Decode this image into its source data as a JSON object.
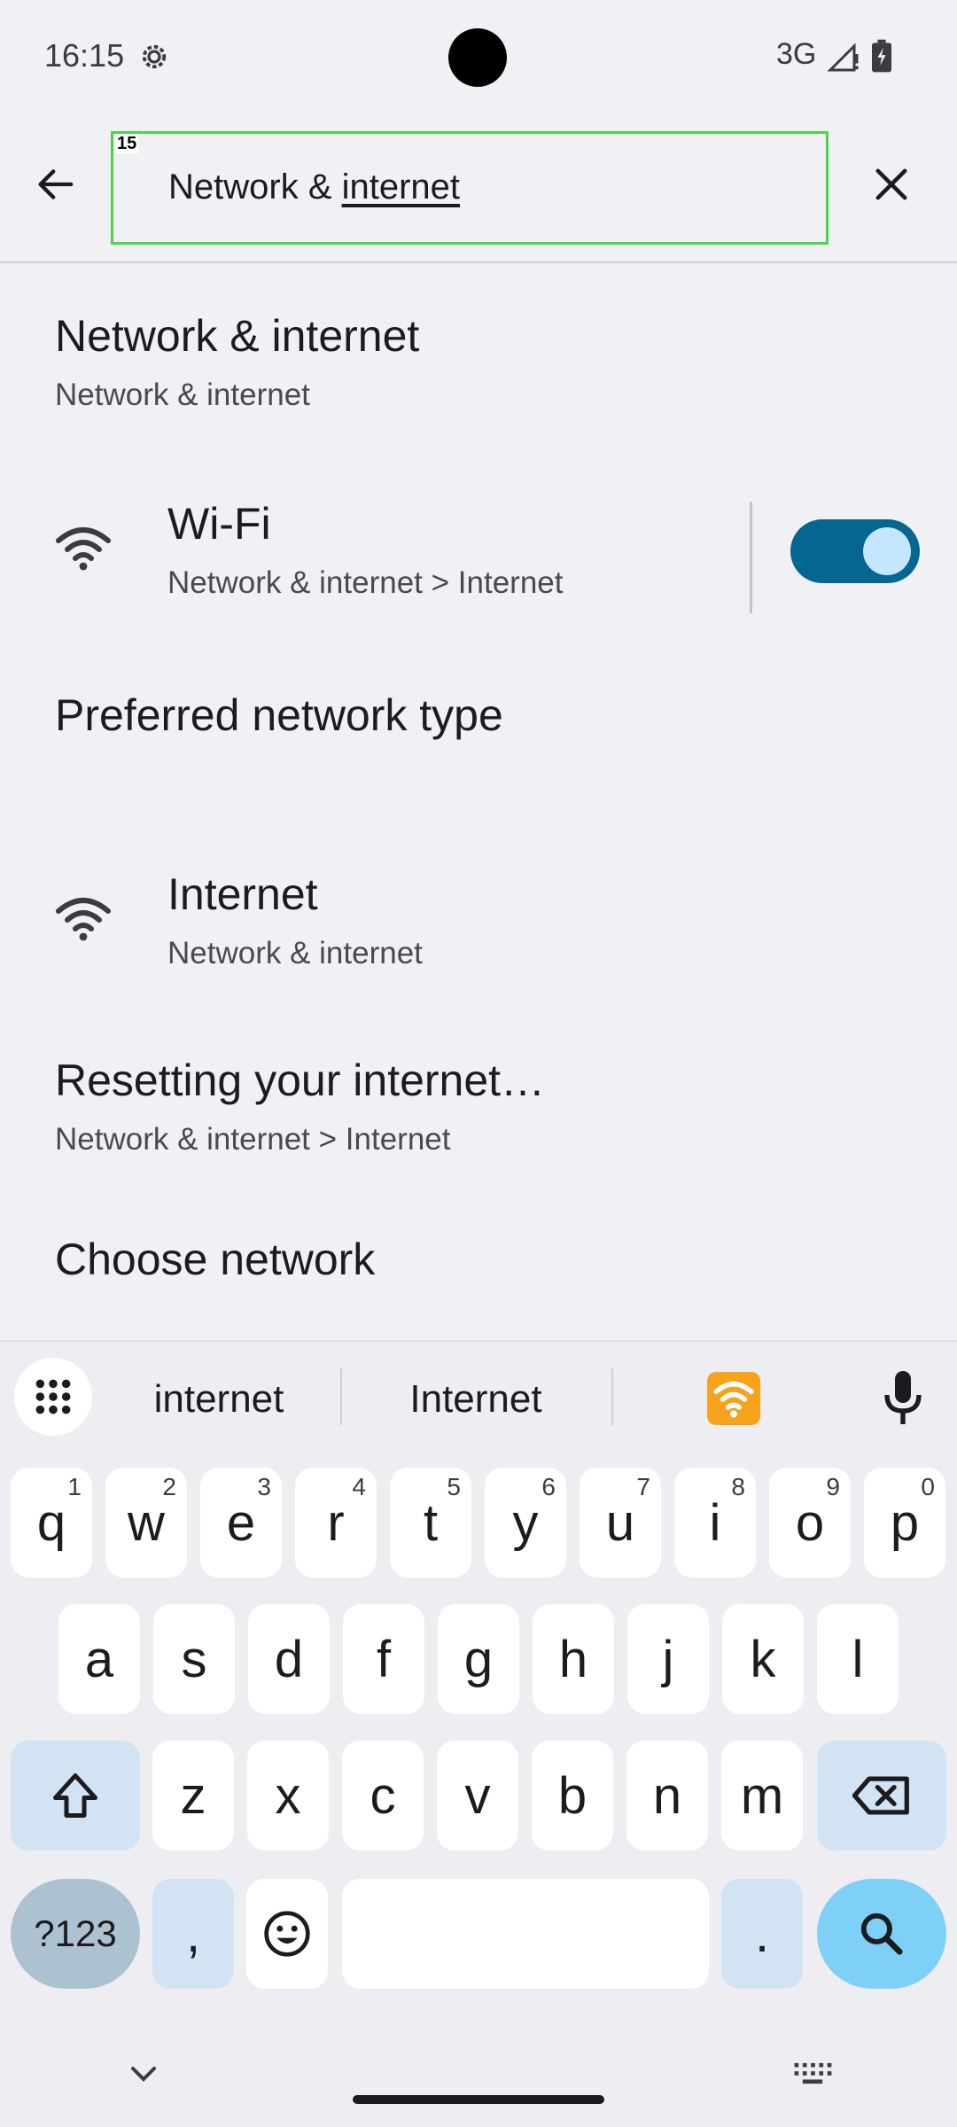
{
  "status": {
    "time": "16:15",
    "network": "3G"
  },
  "search": {
    "tag": "15",
    "query_prefix": "Network & ",
    "query_underlined": "internet"
  },
  "results": [
    {
      "title": "Network & internet",
      "subtitle": "Network & internet"
    },
    {
      "title": "Wi-Fi",
      "subtitle": "Network & internet > Internet",
      "toggle_on": true
    },
    {
      "title": "Preferred network type"
    },
    {
      "title": "Internet",
      "subtitle": "Network & internet"
    },
    {
      "title": "Resetting your internet…",
      "subtitle": "Network & internet > Internet"
    },
    {
      "title": "Choose network"
    }
  ],
  "keyboard": {
    "suggestions": [
      "internet",
      "Internet"
    ],
    "emoji_suggestion_icon": "wifi-emoji",
    "row1": [
      {
        "k": "q",
        "n": "1"
      },
      {
        "k": "w",
        "n": "2"
      },
      {
        "k": "e",
        "n": "3"
      },
      {
        "k": "r",
        "n": "4"
      },
      {
        "k": "t",
        "n": "5"
      },
      {
        "k": "y",
        "n": "6"
      },
      {
        "k": "u",
        "n": "7"
      },
      {
        "k": "i",
        "n": "8"
      },
      {
        "k": "o",
        "n": "9"
      },
      {
        "k": "p",
        "n": "0"
      }
    ],
    "row2": [
      "a",
      "s",
      "d",
      "f",
      "g",
      "h",
      "j",
      "k",
      "l"
    ],
    "row3": [
      "z",
      "x",
      "c",
      "v",
      "b",
      "n",
      "m"
    ],
    "sym_label": "?123",
    "comma_label": ",",
    "period_label": "."
  },
  "colors": {
    "toggle_on": "#05668f",
    "search_key": "#7fd0f7",
    "highlight_box": "#4cd34a"
  }
}
